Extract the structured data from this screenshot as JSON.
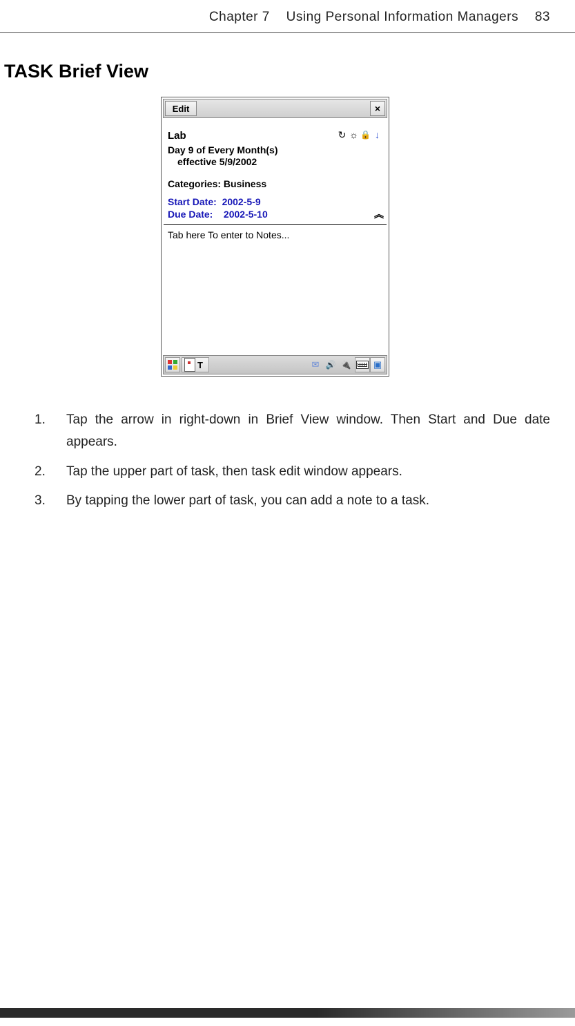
{
  "header": {
    "chapter": "Chapter 7",
    "title": "Using Personal Information Managers",
    "page": "83"
  },
  "heading": "TASK Brief View",
  "screenshot": {
    "menubar": {
      "edit": "Edit",
      "close": "×"
    },
    "task_name": "Lab",
    "top_icons": {
      "sync": "↻",
      "alarm": "☼",
      "lock": "🔒",
      "arrow": "↓"
    },
    "recurrence_l1": "Day 9 of Every Month(s)",
    "recurrence_l2": "effective 5/9/2002",
    "categories_label": "Categories: Business",
    "start_label": "Start Date:",
    "start_value": "2002-5-9",
    "due_label": "Due Date:",
    "due_value": "2002-5-10",
    "collapse": "︽",
    "notes_placeholder": "Tab here To enter to Notes...",
    "taskbar": {
      "start": "⊞",
      "clipboard": "📋",
      "T": "T",
      "mail": "✉",
      "sound": "🔊",
      "plug": "🔌",
      "keyboard": "⌨",
      "window": "▣"
    }
  },
  "steps": [
    {
      "num": "1.",
      "text": "Tap the arrow in right-down in Brief View window. Then Start and Due date appears."
    },
    {
      "num": "2.",
      "text": "Tap the upper part of task, then task edit window appears."
    },
    {
      "num": "3.",
      "text": "By tapping the lower part of task, you can add a note to a task."
    }
  ]
}
